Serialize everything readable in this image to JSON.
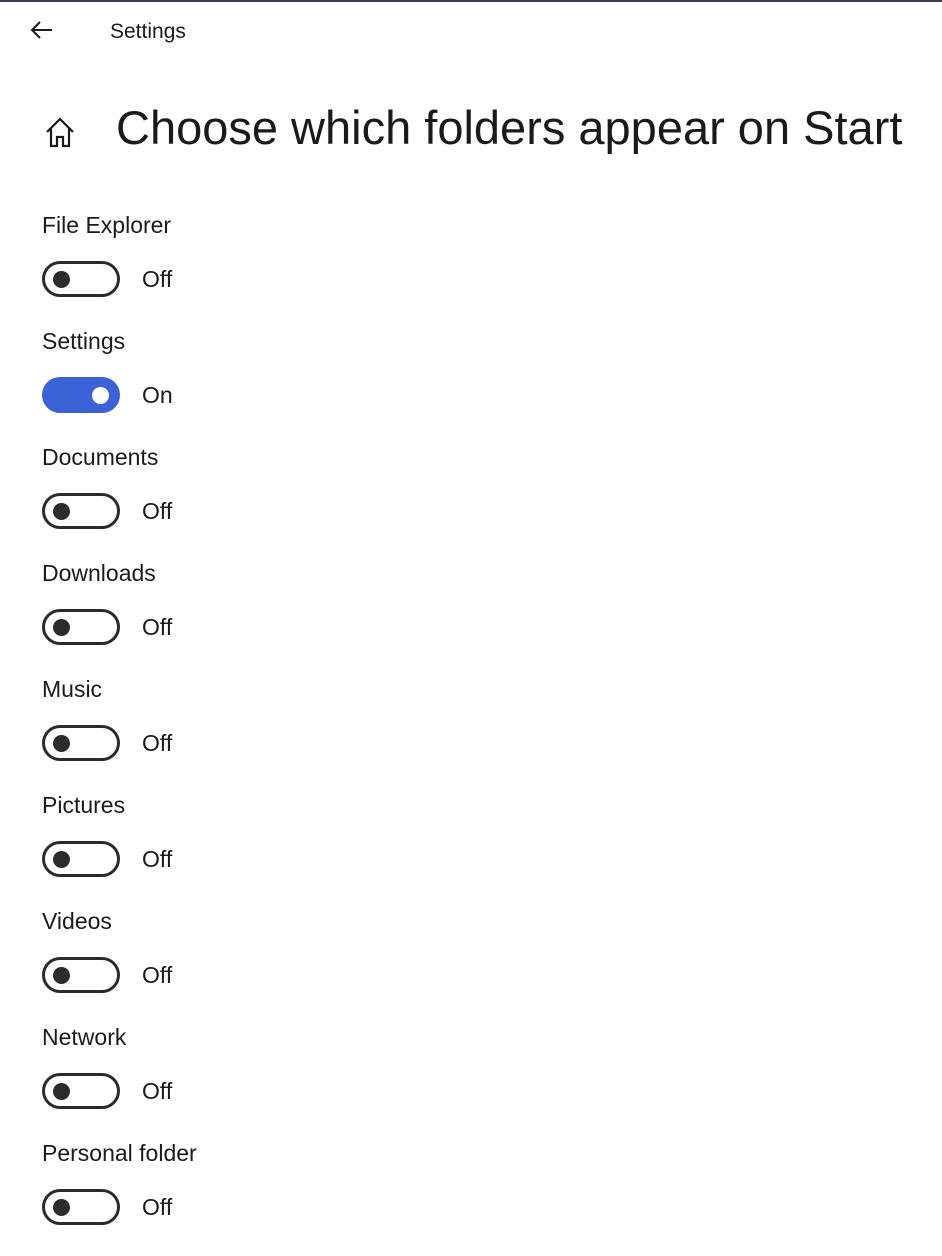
{
  "window": {
    "title": "Settings",
    "accent_color": "#3b62d6"
  },
  "page": {
    "title": "Choose which folders appear on Start"
  },
  "icons": {
    "back": "back-arrow-icon",
    "home": "home-icon"
  },
  "settings": [
    {
      "label": "File Explorer",
      "state": "Off",
      "on": false
    },
    {
      "label": "Settings",
      "state": "On",
      "on": true
    },
    {
      "label": "Documents",
      "state": "Off",
      "on": false
    },
    {
      "label": "Downloads",
      "state": "Off",
      "on": false
    },
    {
      "label": "Music",
      "state": "Off",
      "on": false
    },
    {
      "label": "Pictures",
      "state": "Off",
      "on": false
    },
    {
      "label": "Videos",
      "state": "Off",
      "on": false
    },
    {
      "label": "Network",
      "state": "Off",
      "on": false
    },
    {
      "label": "Personal folder",
      "state": "Off",
      "on": false
    }
  ]
}
